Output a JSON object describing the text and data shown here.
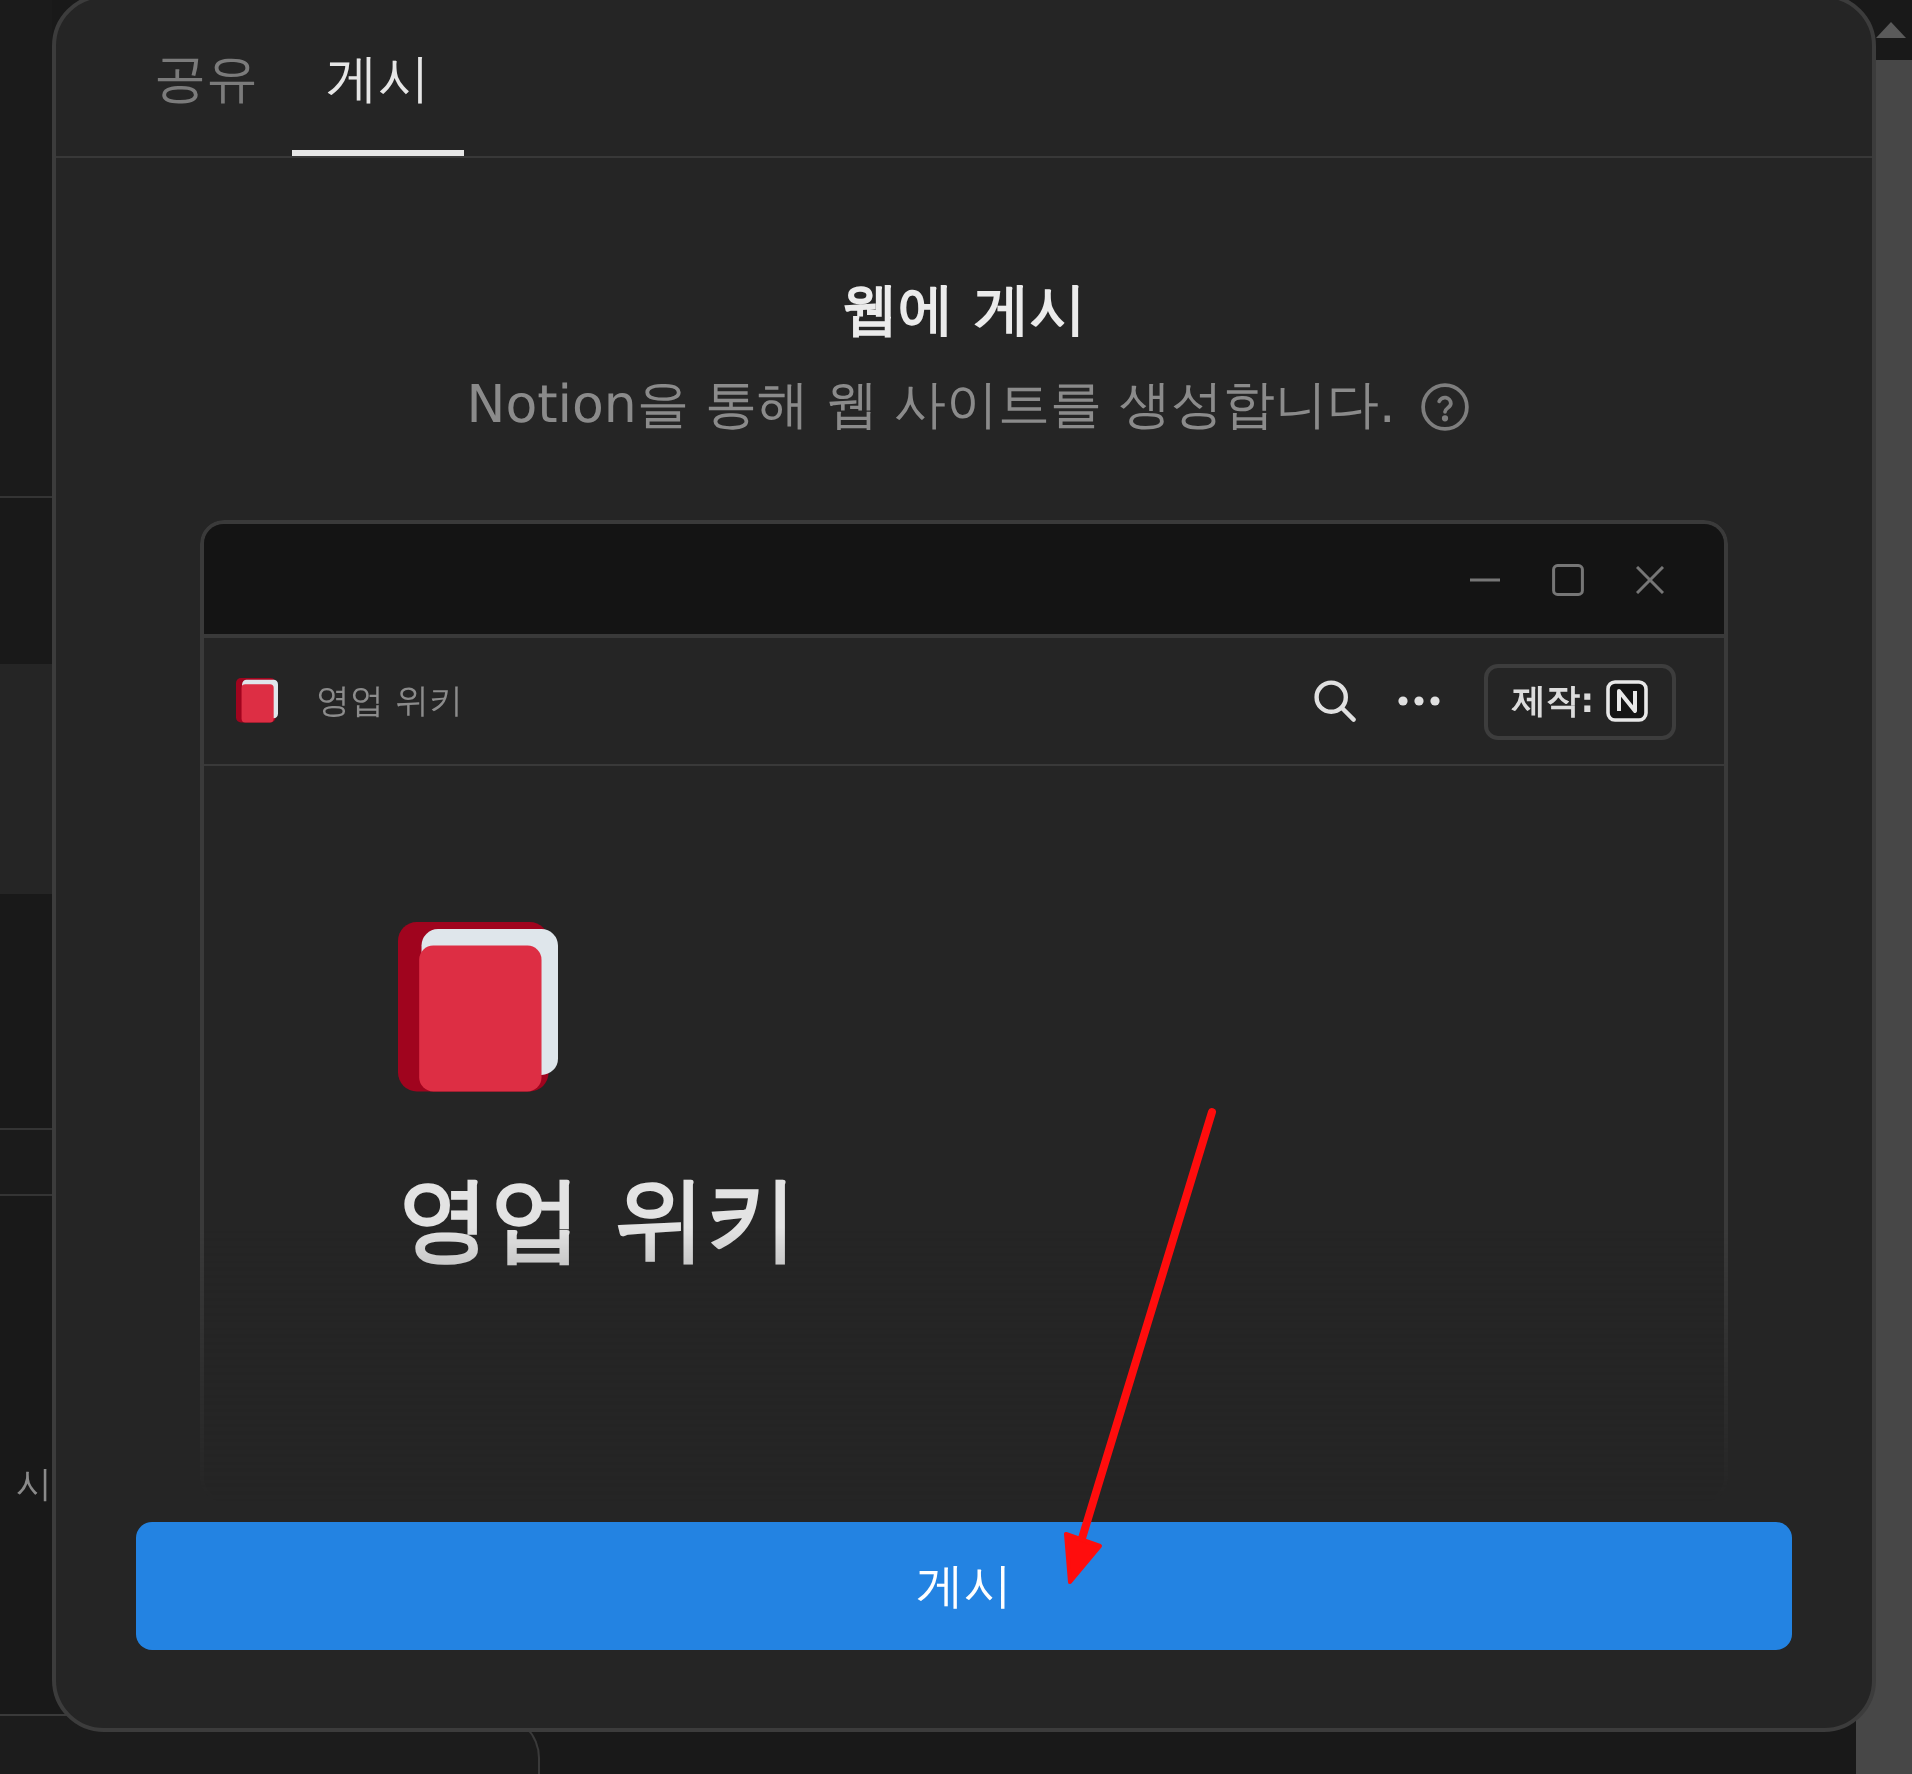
{
  "background_app": {
    "sidebar_text": "시"
  },
  "dialog": {
    "tabs": [
      {
        "label": "공유",
        "selected": false
      },
      {
        "label": "게시",
        "selected": true
      }
    ],
    "heading": "웹에 게시",
    "description": "Notion을 통해 웹 사이트를 생성합니다.",
    "preview": {
      "page_title": "영업 위키",
      "badge_label": "제작:",
      "page_heading": "영업 위키"
    },
    "publish_button": "게시"
  }
}
